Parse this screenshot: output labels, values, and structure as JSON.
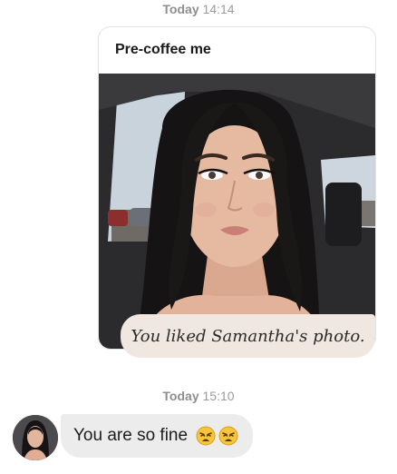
{
  "timestamps": [
    {
      "day": "Today",
      "time": "14:14"
    },
    {
      "day": "Today",
      "time": "15:10"
    }
  ],
  "prompt": {
    "title": "Pre-coffee me"
  },
  "liked_notice": "You liked Samantha's photo.",
  "message": {
    "text": "You are so fine",
    "emojis": [
      "weary-face-emoji",
      "weary-face-emoji"
    ]
  },
  "colors": {
    "liked_bubble": "#efe7e0",
    "message_bubble": "#ececec",
    "timestamp": "#9b9b9b"
  }
}
